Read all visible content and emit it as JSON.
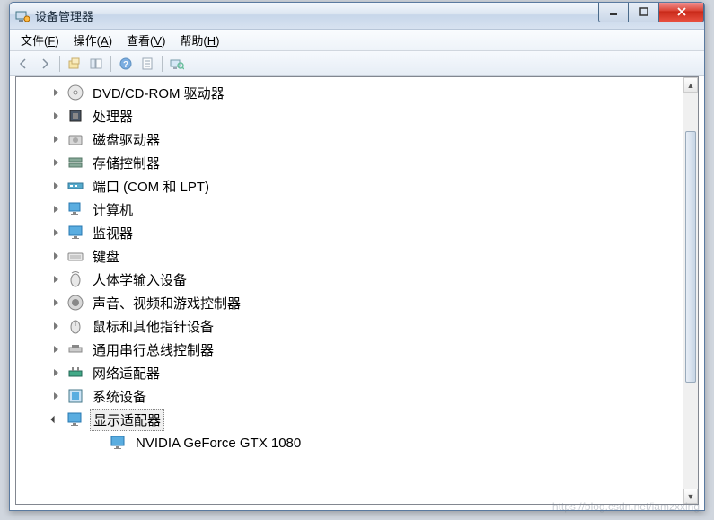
{
  "titlebar": {
    "title": "设备管理器"
  },
  "menubar": {
    "file": "文件",
    "file_u": "F",
    "action": "操作",
    "action_u": "A",
    "view": "查看",
    "view_u": "V",
    "help": "帮助",
    "help_u": "H"
  },
  "toolbar": {
    "back": "back",
    "forward": "forward",
    "up": "up-folder",
    "show_hide": "show-hide-console-tree",
    "help": "help",
    "properties": "properties",
    "scan": "scan-hardware"
  },
  "tree": [
    {
      "id": "dvd",
      "label": "DVD/CD-ROM 驱动器",
      "expanded": false,
      "icon": "disc"
    },
    {
      "id": "cpu",
      "label": "处理器",
      "expanded": false,
      "icon": "chip"
    },
    {
      "id": "disk",
      "label": "磁盘驱动器",
      "expanded": false,
      "icon": "hdd"
    },
    {
      "id": "storage",
      "label": "存储控制器",
      "expanded": false,
      "icon": "storage"
    },
    {
      "id": "ports",
      "label": "端口 (COM 和 LPT)",
      "expanded": false,
      "icon": "port"
    },
    {
      "id": "computer",
      "label": "计算机",
      "expanded": false,
      "icon": "pc"
    },
    {
      "id": "monitor",
      "label": "监视器",
      "expanded": false,
      "icon": "monitor"
    },
    {
      "id": "keyboard",
      "label": "键盘",
      "expanded": false,
      "icon": "keyboard"
    },
    {
      "id": "hid",
      "label": "人体学输入设备",
      "expanded": false,
      "icon": "hid"
    },
    {
      "id": "audio",
      "label": "声音、视频和游戏控制器",
      "expanded": false,
      "icon": "speaker"
    },
    {
      "id": "mouse",
      "label": "鼠标和其他指针设备",
      "expanded": false,
      "icon": "mouse"
    },
    {
      "id": "usb",
      "label": "通用串行总线控制器",
      "expanded": false,
      "icon": "usb"
    },
    {
      "id": "net",
      "label": "网络适配器",
      "expanded": false,
      "icon": "net"
    },
    {
      "id": "sys",
      "label": "系统设备",
      "expanded": false,
      "icon": "sys"
    },
    {
      "id": "display",
      "label": "显示适配器",
      "expanded": true,
      "selected": true,
      "icon": "display",
      "children": [
        {
          "id": "gpu",
          "label": "NVIDIA GeForce GTX 1080",
          "icon": "display"
        }
      ]
    }
  ],
  "watermark": "https://blog.csdn.net/iamzxxing"
}
